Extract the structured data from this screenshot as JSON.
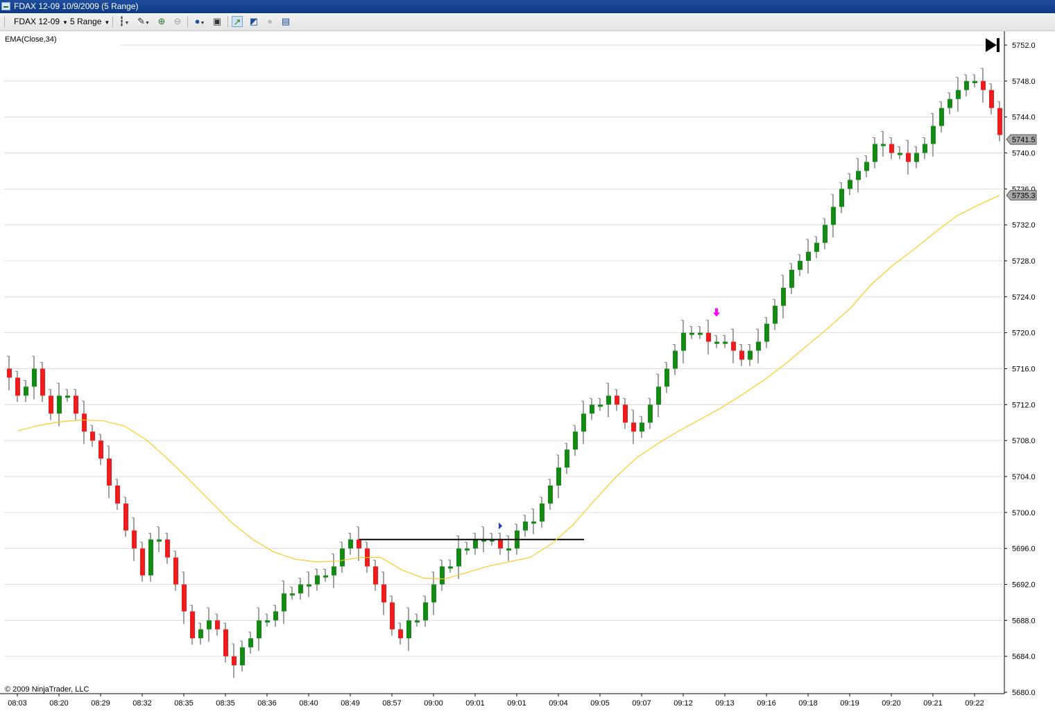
{
  "window": {
    "title": "FDAX 12-09  10/9/2009 (5 Range)"
  },
  "toolbar": {
    "instrument": "FDAX 12-09",
    "period": "5 Range"
  },
  "icons": [
    "bar-style-icon",
    "drawing-tool-icon",
    "zoom-in-icon",
    "zoom-out-icon",
    "globe-icon",
    "properties-icon",
    "strategy-icon",
    "indicators-icon",
    "orders-icon",
    "data-box-icon"
  ],
  "footer": {
    "copyright": "© 2009 NinjaTrader, LLC"
  },
  "colors": {
    "up": "#138a13",
    "down": "#ee1c1c",
    "wick": "#808080",
    "ema": "#ffc81e",
    "grid": "#dcdcdc",
    "marker": "#ff00ff",
    "entry": "#1e3cd2"
  },
  "chart_data": {
    "type": "candlestick",
    "indicator_label": "EMA(Close,34)",
    "x_tick_labels": [
      "08:03",
      "08:20",
      "08:29",
      "08:32",
      "08:35",
      "08:35",
      "08:36",
      "08:40",
      "08:49",
      "08:57",
      "09:00",
      "09:01",
      "09:01",
      "09:04",
      "09:05",
      "09:07",
      "09:12",
      "09:13",
      "09:16",
      "09:18",
      "09:19",
      "09:20",
      "09:21",
      "09:22"
    ],
    "y_tick_labels": [
      "5752.0",
      "5748.0",
      "5744.0",
      "5740.0",
      "5736.0",
      "5732.0",
      "5728.0",
      "5724.0",
      "5720.0",
      "5716.0",
      "5712.0",
      "5708.0",
      "5704.0",
      "5700.0",
      "5696.0",
      "5692.0",
      "5688.0",
      "5684.0",
      "5680.0"
    ],
    "ylim": [
      5680,
      5752
    ],
    "last_price": "5741.5",
    "ema_value": "5735.3",
    "horizontal_line": 5697.0,
    "candle_style": {
      "up": "green",
      "down": "red"
    },
    "closes": [
      5715,
      5713,
      5714,
      5716,
      5713,
      5711,
      5713,
      5713,
      5711,
      5709,
      5708,
      5706,
      5703,
      5701,
      5698,
      5696,
      5693,
      5697,
      5697,
      5695,
      5692,
      5689,
      5686,
      5687,
      5688,
      5687,
      5684,
      5683,
      5685,
      5686,
      5688,
      5688,
      5689,
      5691,
      5691,
      5692,
      5692,
      5693,
      5693,
      5694,
      5696,
      5697,
      5696,
      5694,
      5692,
      5690,
      5687,
      5686,
      5688,
      5688,
      5690,
      5692,
      5694,
      5694,
      5696,
      5696,
      5697,
      5697,
      5697,
      5696,
      5696,
      5698,
      5699,
      5699,
      5701,
      5703,
      5705,
      5707,
      5709,
      5711,
      5712,
      5712,
      5713,
      5712,
      5710,
      5709,
      5710,
      5712,
      5714,
      5716,
      5718,
      5720,
      5720,
      5720,
      5719,
      5719,
      5719,
      5718,
      5717,
      5718,
      5719,
      5721,
      5723,
      5725,
      5727,
      5728,
      5729,
      5730,
      5732,
      5734,
      5736,
      5737,
      5738,
      5739,
      5741,
      5741,
      5740,
      5740,
      5739,
      5740,
      5741,
      5743,
      5745,
      5746,
      5747,
      5748,
      5748,
      5747,
      5745,
      5742
    ],
    "ema": [
      5709.1,
      5709.7,
      5710.1,
      5710.3,
      5710.2,
      5709.6,
      5708.1,
      5706.0,
      5703.7,
      5701.3,
      5698.9,
      5697.0,
      5695.6,
      5694.8,
      5694.5,
      5694.6,
      5695.0,
      5695.0,
      5693.6,
      5692.7,
      5692.6,
      5693.3,
      5694.0,
      5694.5,
      5695.0,
      5696.5,
      5698.6,
      5701.3,
      5703.9,
      5706.1,
      5707.7,
      5709.1,
      5710.4,
      5711.7,
      5713.2,
      5714.8,
      5716.6,
      5718.6,
      5720.6,
      5722.7,
      5725.4,
      5727.5,
      5729.3,
      5731.2,
      5733.0,
      5734.2,
      5735.3
    ],
    "markers": [
      {
        "type": "entry",
        "name": "long-entry",
        "price": 5698.5
      },
      {
        "type": "exit",
        "name": "exit-arrow",
        "price": 5722.1
      }
    ]
  }
}
